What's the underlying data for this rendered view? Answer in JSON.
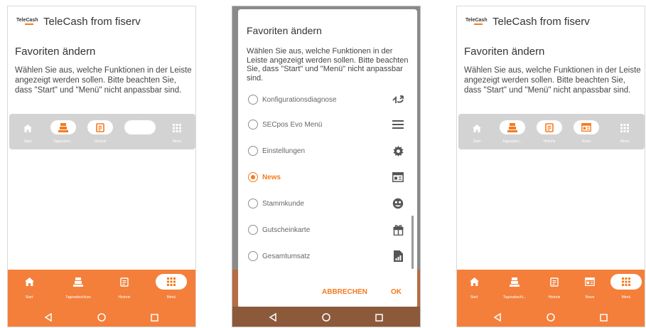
{
  "colors": {
    "accent": "#f47b20",
    "nav_bg": "#f47f3a",
    "fav_bar_bg": "#d3d3d3"
  },
  "screen1": {
    "logo_text": "TeleCash",
    "app_title": "TeleCash from fiserv",
    "page_title": "Favoriten ändern",
    "description": "Wählen Sie aus, welche Funktionen in der Leiste angezeigt werden sollen. Bitte beachten Sie, dass \"Start\" und \"Menü\" nicht anpassbar sind.",
    "favorites": [
      {
        "label": "Start",
        "icon": "home-icon",
        "selected": false
      },
      {
        "label": "Tagesabsc...",
        "icon": "cash-register-icon",
        "selected": true
      },
      {
        "label": "Historie",
        "icon": "history-icon",
        "selected": true
      },
      {
        "label": "",
        "icon": "empty-slot",
        "selected": true
      },
      {
        "label": "Menü",
        "icon": "grid-icon",
        "selected": false
      }
    ],
    "nav": [
      {
        "label": "Start",
        "icon": "home-icon"
      },
      {
        "label": "Tagesabschluss",
        "icon": "cash-register-icon"
      },
      {
        "label": "Historie",
        "icon": "history-icon"
      },
      {
        "label": "Menü",
        "icon": "grid-icon",
        "active": true
      }
    ]
  },
  "screen2": {
    "dialog_title": "Favoriten ändern",
    "description": "Wählen Sie aus, welche Funktionen in der Leiste angezeigt werden sollen. Bitte beachten Sie, dass \"Start\" und \"Menü\" nicht anpassbar sind.",
    "options": [
      {
        "label": "Konfigurationsdiagnose",
        "icon": "sync-icon",
        "selected": false
      },
      {
        "label": "SECpos Evo Menü",
        "icon": "menu-icon",
        "selected": false
      },
      {
        "label": "Einstellungen",
        "icon": "gear-icon",
        "selected": false
      },
      {
        "label": "News",
        "icon": "news-icon",
        "selected": true
      },
      {
        "label": "Stammkunde",
        "icon": "customer-icon",
        "selected": false
      },
      {
        "label": "Gutscheinkarte",
        "icon": "gift-icon",
        "selected": false
      },
      {
        "label": "Gesamtumsatz",
        "icon": "report-icon",
        "selected": false
      }
    ],
    "cancel_label": "ABBRECHEN",
    "ok_label": "OK"
  },
  "screen3": {
    "logo_text": "TeleCash",
    "app_title": "TeleCash from fiserv",
    "page_title": "Favoriten ändern",
    "description": "Wählen Sie aus, welche Funktionen in der Leiste angezeigt werden sollen. Bitte beachten Sie, dass \"Start\" und \"Menü\" nicht anpassbar sind.",
    "favorites": [
      {
        "label": "Start",
        "icon": "home-icon",
        "selected": false
      },
      {
        "label": "Tagesabsc...",
        "icon": "cash-register-icon",
        "selected": true
      },
      {
        "label": "Historie",
        "icon": "history-icon",
        "selected": true
      },
      {
        "label": "News",
        "icon": "news-icon",
        "selected": true
      },
      {
        "label": "Menü",
        "icon": "grid-icon",
        "selected": false
      }
    ],
    "nav": [
      {
        "label": "Start",
        "icon": "home-icon"
      },
      {
        "label": "Tagesabschl...",
        "icon": "cash-register-icon"
      },
      {
        "label": "Historie",
        "icon": "history-icon"
      },
      {
        "label": "News",
        "icon": "news-icon"
      },
      {
        "label": "Menü",
        "icon": "grid-icon",
        "active": true
      }
    ]
  }
}
